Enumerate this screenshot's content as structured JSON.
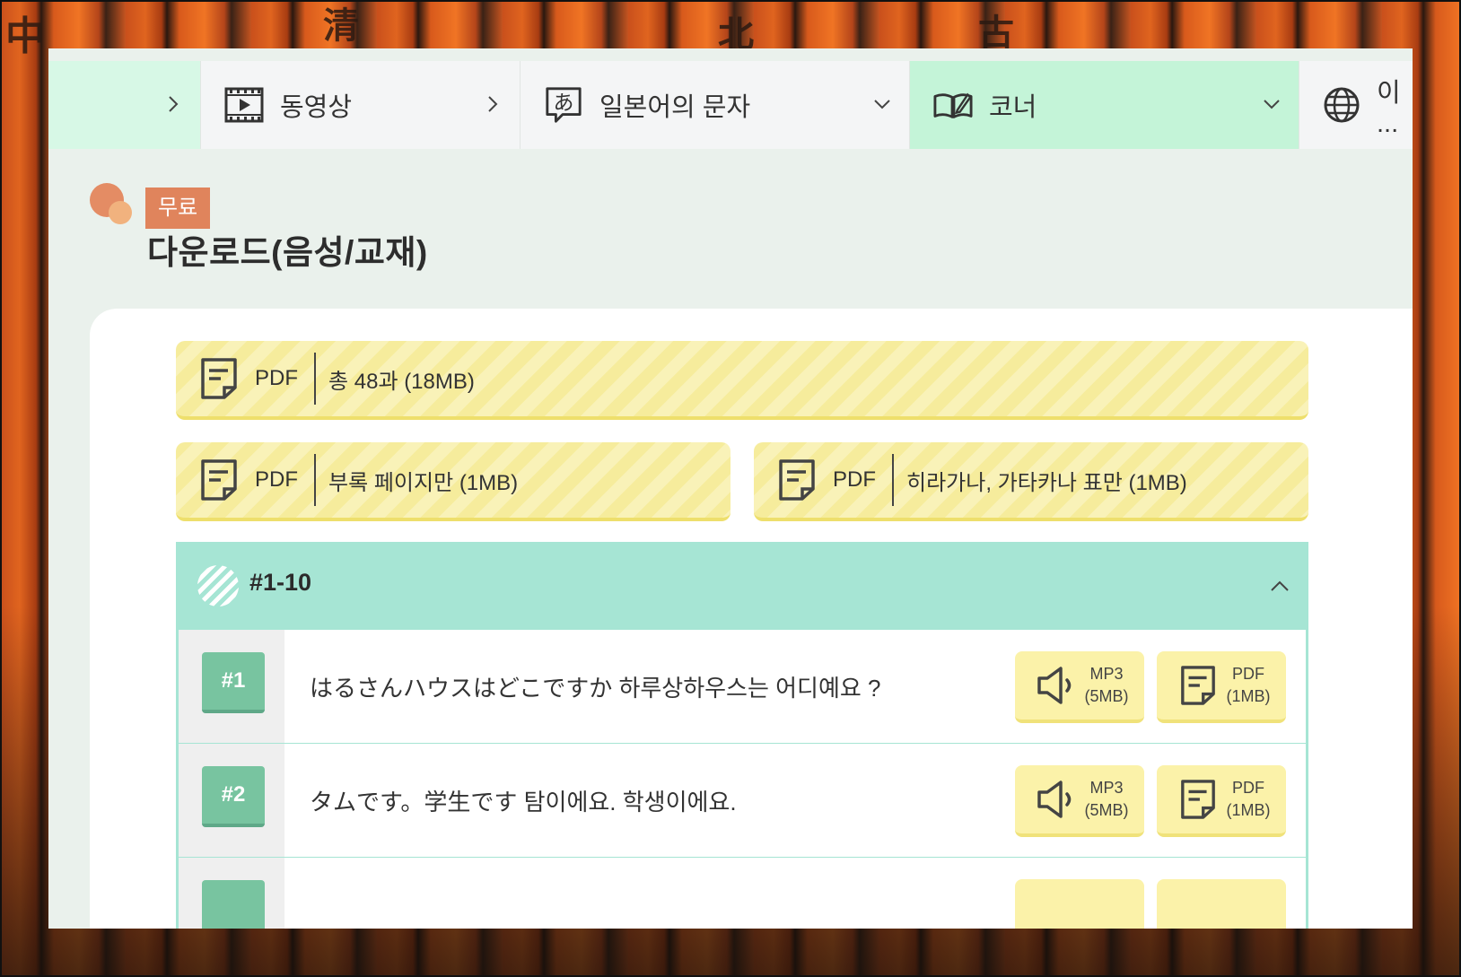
{
  "nav": {
    "items": [
      {
        "label": "",
        "icon": "chevron-right-icon"
      },
      {
        "label": "동영상",
        "icon": "film-icon"
      },
      {
        "label": "일본어의 문자",
        "icon": "hiragana-a-icon"
      },
      {
        "label": "코너",
        "icon": "open-book-icon"
      },
      {
        "label": "이 ...",
        "icon": "globe-icon"
      }
    ]
  },
  "header": {
    "badge": "무료",
    "title": "다운로드(음성/교재)"
  },
  "downloads": [
    {
      "type": "PDF",
      "desc": "총 48과 (18MB)"
    },
    {
      "type": "PDF",
      "desc": "부록 페이지만 (1MB)"
    },
    {
      "type": "PDF",
      "desc": "히라가나, 가타카나 표만 (1MB)"
    }
  ],
  "accordion": {
    "title": "#1-10",
    "rows": [
      {
        "num": "#1",
        "text": "はるさんハウスはどこですか 하루상하우스는 어디예요 ?",
        "mp3_label": "MP3",
        "mp3_size": "(5MB)",
        "pdf_label": "PDF",
        "pdf_size": "(1MB)"
      },
      {
        "num": "#2",
        "text": "タムです。学生です 탐이에요. 학생이에요.",
        "mp3_label": "MP3",
        "mp3_size": "(5MB)",
        "pdf_label": "PDF",
        "pdf_size": "(1MB)"
      },
      {
        "num": "",
        "text": "",
        "mp3_label": "",
        "mp3_size": "",
        "pdf_label": "",
        "pdf_size": ""
      }
    ]
  },
  "colors": {
    "nav_active": "#c4f4d8",
    "badge": "#e0845c",
    "accordion_header": "#a6e5d4",
    "number_badge": "#78c4a0",
    "download_bg": "#f6ec9c"
  }
}
